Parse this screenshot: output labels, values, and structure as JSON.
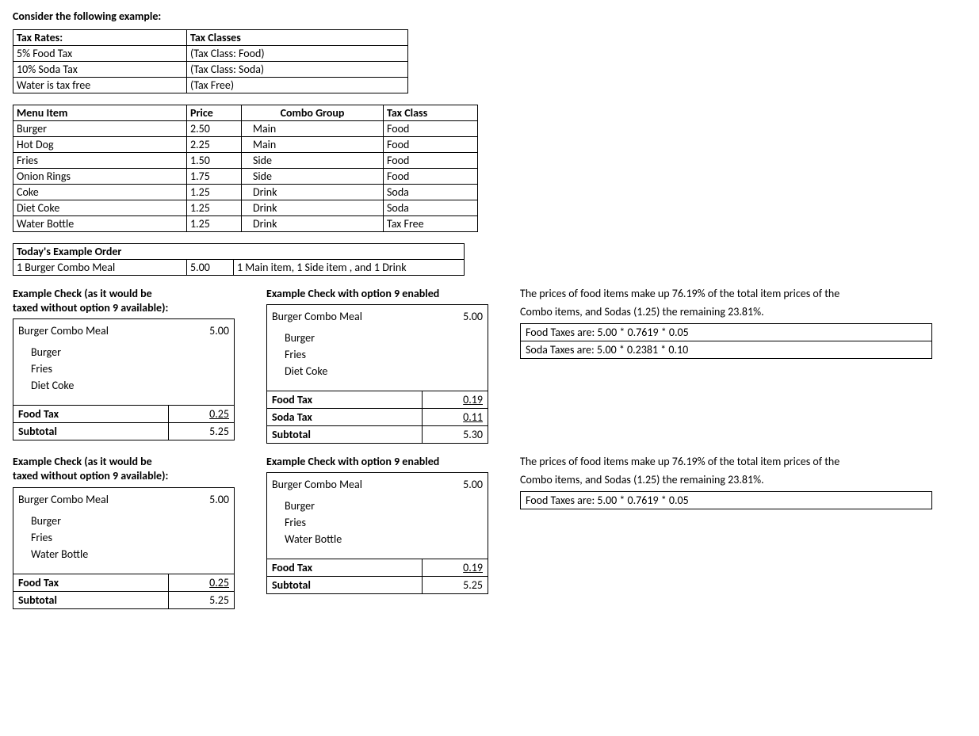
{
  "heading": "Consider the following example:",
  "taxTable": {
    "head": {
      "rates": "Tax Rates:",
      "classes": "Tax Classes"
    },
    "rows": [
      {
        "rate": "5% Food Tax",
        "class": "(Tax Class: Food)"
      },
      {
        "rate": "10% Soda Tax",
        "class": "(Tax Class: Soda)"
      },
      {
        "rate": "Water is tax free",
        "class": "(Tax Free)"
      }
    ]
  },
  "menuTable": {
    "head": {
      "item": "Menu Item",
      "price": "Price",
      "combo": "Combo Group",
      "taxc": "Tax Class"
    },
    "rows": [
      {
        "item": "Burger",
        "price": "2.50",
        "combo": "Main",
        "taxc": "Food"
      },
      {
        "item": "Hot Dog",
        "price": "2.25",
        "combo": "Main",
        "taxc": "Food"
      },
      {
        "item": "Fries",
        "price": "1.50",
        "combo": "Side",
        "taxc": "Food"
      },
      {
        "item": "Onion Rings",
        "price": "1.75",
        "combo": "Side",
        "taxc": "Food"
      },
      {
        "item": "Coke",
        "price": "1.25",
        "combo": "Drink",
        "taxc": "Soda"
      },
      {
        "item": "Diet Coke",
        "price": "1.25",
        "combo": "Drink",
        "taxc": "Soda"
      },
      {
        "item": "Water Bottle",
        "price": "1.25",
        "combo": "Drink",
        "taxc": "Tax Free"
      }
    ]
  },
  "orderTable": {
    "title": "Today's Example Order",
    "row": {
      "name": "1 Burger Combo Meal",
      "price": "5.00",
      "desc": "1 Main item, 1 Side item , and 1 Drink"
    }
  },
  "checks": [
    {
      "left": {
        "title1": "Example Check (as it would be",
        "title2": "taxed without option 9 available):",
        "name": "Burger Combo Meal",
        "price": "5.00",
        "items": [
          "Burger",
          "Fries",
          "Diet Coke"
        ],
        "totals": [
          {
            "label": "Food Tax",
            "amt": "0.25",
            "u": true
          },
          {
            "label": "Subtotal",
            "amt": "5.25",
            "u": false
          }
        ]
      },
      "right": {
        "title": "Example Check with option 9 enabled",
        "name": "Burger Combo Meal",
        "price": "5.00",
        "items": [
          "Burger",
          "Fries",
          "Diet Coke"
        ],
        "totals": [
          {
            "label": "Food Tax",
            "amt": "0.19",
            "u": true
          },
          {
            "label": "Soda Tax",
            "amt": "0.11",
            "u": true
          },
          {
            "label": "Subtotal",
            "amt": "5.30",
            "u": false
          }
        ]
      },
      "notes": {
        "p1": "The prices of food items make up 76.19% of the total item prices of the",
        "p2": "Combo items, and Sodas (1.25) the remaining 23.81%.",
        "formulas": [
          "Food Taxes are: 5.00 * 0.7619 * 0.05",
          "Soda Taxes are: 5.00 * 0.2381 * 0.10"
        ]
      }
    },
    {
      "left": {
        "title1": "Example Check (as it would be",
        "title2": "taxed without option 9 available):",
        "name": "Burger Combo Meal",
        "price": "5.00",
        "items": [
          "Burger",
          "Fries",
          "Water Bottle"
        ],
        "totals": [
          {
            "label": "Food Tax",
            "amt": "0.25",
            "u": true
          },
          {
            "label": "Subtotal",
            "amt": "5.25",
            "u": false
          }
        ]
      },
      "right": {
        "title": "Example Check with option 9 enabled",
        "name": "Burger Combo Meal",
        "price": "5.00",
        "items": [
          "Burger",
          "Fries",
          "Water Bottle"
        ],
        "totals": [
          {
            "label": "Food Tax",
            "amt": "0.19",
            "u": true
          },
          {
            "label": "Subtotal",
            "amt": "5.25",
            "u": false
          }
        ]
      },
      "notes": {
        "p1": "The prices of food items make up 76.19% of the total item prices of the",
        "p2": "Combo items, and Sodas (1.25) the remaining 23.81%.",
        "formulas": [
          "Food Taxes are: 5.00 * 0.7619 * 0.05"
        ]
      }
    }
  ]
}
